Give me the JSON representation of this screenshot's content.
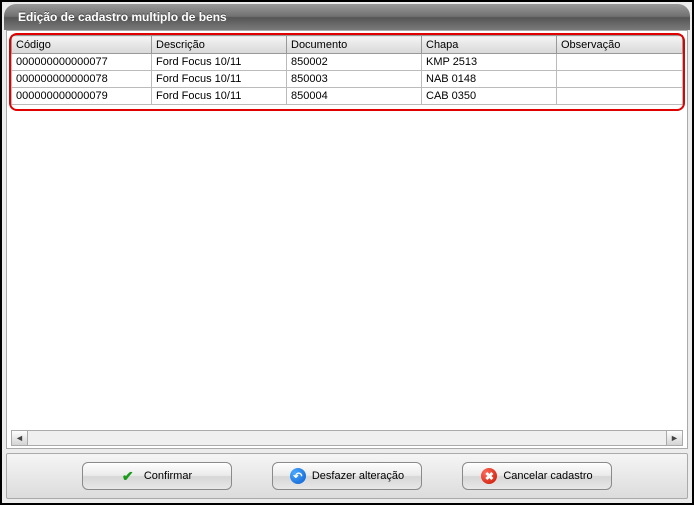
{
  "header": {
    "title": "Edição de cadastro multiplo de bens"
  },
  "grid": {
    "columns": {
      "codigo": "Código",
      "descricao": "Descrição",
      "documento": "Documento",
      "chapa": "Chapa",
      "observacao": "Observação"
    },
    "rows": [
      {
        "codigo": "000000000000077",
        "descricao": "Ford Focus 10/11",
        "documento": "850002",
        "chapa": "KMP 2513",
        "observacao": ""
      },
      {
        "codigo": "000000000000078",
        "descricao": "Ford Focus 10/11",
        "documento": "850003",
        "chapa": "NAB 0148",
        "observacao": ""
      },
      {
        "codigo": "000000000000079",
        "descricao": "Ford Focus 10/11",
        "documento": "850004",
        "chapa": "CAB 0350",
        "observacao": ""
      }
    ]
  },
  "buttons": {
    "confirm": "Confirmar",
    "undo": "Desfazer alteração",
    "cancel": "Cancelar cadastro"
  },
  "scroll": {
    "left": "◄",
    "right": "►"
  }
}
